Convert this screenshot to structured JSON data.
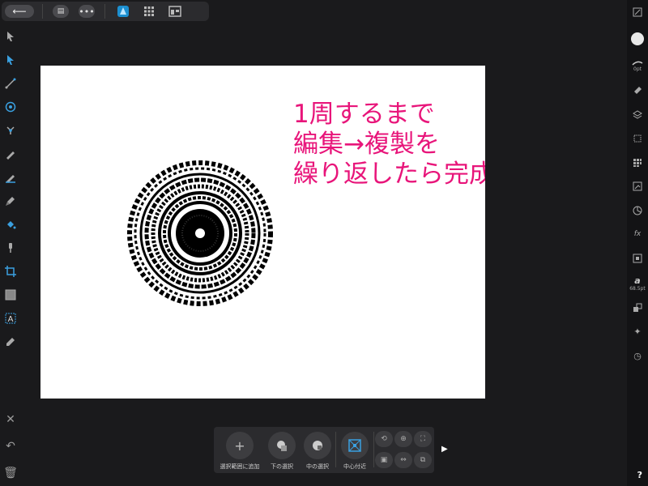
{
  "canvas": {
    "annotation_lines": [
      "1周するまで",
      "編集→複製を",
      "繰り返したら完成"
    ],
    "annotation_color": "#e8157a"
  },
  "topbar": {
    "back_icon": "back-arrow-icon",
    "save_icon": "save-icon",
    "more_icon": "more-dots-icon",
    "personas": [
      "designer-persona-icon",
      "pixel-persona-icon",
      "export-persona-icon"
    ]
  },
  "context_toolbar": {
    "buttons": [
      {
        "label": "選択範囲に追加",
        "icon": "plus-icon"
      },
      {
        "label": "下の選択",
        "icon": "select-below-icon"
      },
      {
        "label": "中の選択",
        "icon": "select-inside-icon"
      },
      {
        "label": "中心付近",
        "icon": "transform-center-icon"
      }
    ]
  },
  "right_panel": {
    "stroke_width": "0pt",
    "font_size": "68.5pt"
  },
  "accent_color": "#3aa0e0"
}
